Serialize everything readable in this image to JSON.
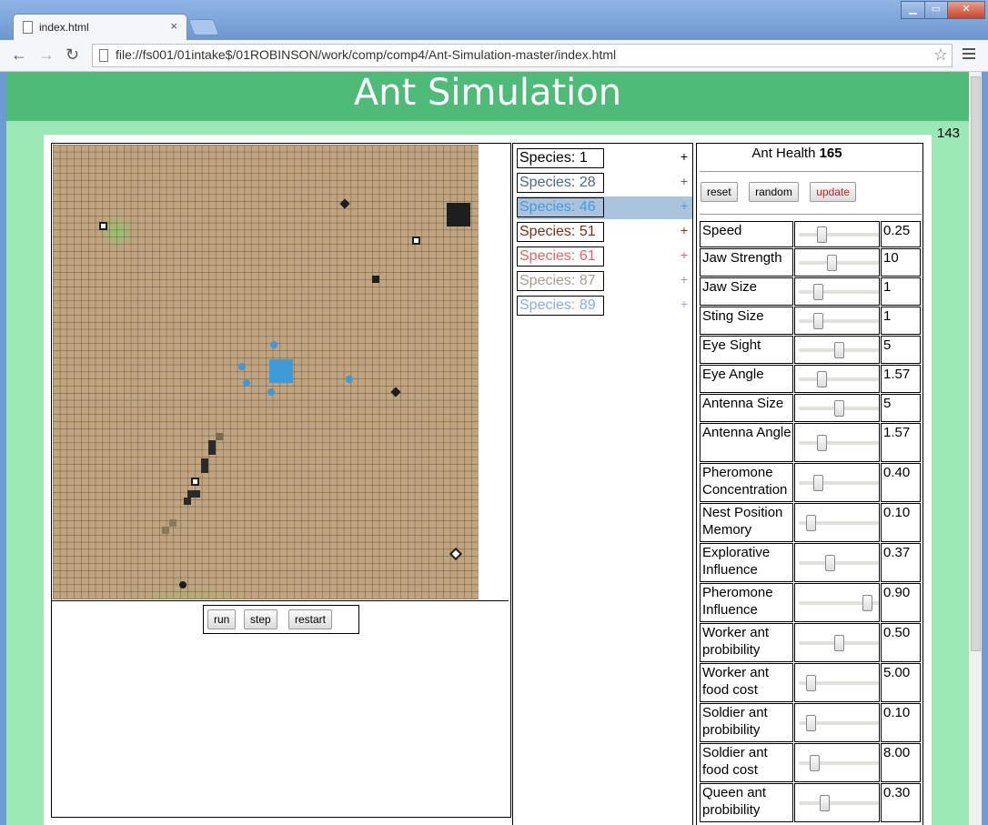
{
  "browser": {
    "tab_title": "index.html",
    "tab_close": "×",
    "url": "file://fs001/01intake$/01ROBINSON/work/comp/comp4/Ant-Simulation-master/index.html",
    "window_buttons": {
      "minimize": "▁",
      "maximize": "▭",
      "close": "✕"
    },
    "nav": {
      "back": "←",
      "forward": "→",
      "reload": "↻"
    },
    "star": "☆"
  },
  "page": {
    "title": "Ant Simulation",
    "counter": "143",
    "controls": {
      "run": "run",
      "step": "step",
      "restart": "restart"
    }
  },
  "species": [
    {
      "label": "Species: 1",
      "color": "#000000",
      "plus_color": "#000000"
    },
    {
      "label": "Species: 28",
      "color": "#4d6a79",
      "plus_color": "#4d6a79"
    },
    {
      "label": "Species: 46",
      "color": "#4a9ad9",
      "plus_color": "#4a9ad9",
      "selected": true
    },
    {
      "label": "Species: 51",
      "color": "#7a2d1b",
      "plus_color": "#7a2d1b"
    },
    {
      "label": "Species: 61",
      "color": "#e0636c",
      "plus_color": "#e0636c"
    },
    {
      "label": "Species: 87",
      "color": "#a5a092",
      "plus_color": "#a5a092"
    },
    {
      "label": "Species: 89",
      "color": "#8fa9d8",
      "plus_color": "#8fa9d8"
    }
  ],
  "plus": "+",
  "health": {
    "label": "Ant Health",
    "value": "165"
  },
  "buttons": {
    "reset": "reset",
    "random": "random",
    "update": "update"
  },
  "params": [
    {
      "label": "Speed",
      "value": "0.25",
      "slider": 0.25
    },
    {
      "label": "Jaw Strength",
      "value": "10",
      "slider": 0.4
    },
    {
      "label": "Jaw Size",
      "value": "1",
      "slider": 0.2
    },
    {
      "label": "Sting Size",
      "value": "1",
      "slider": 0.2
    },
    {
      "label": "Eye Sight",
      "value": "5",
      "slider": 0.5
    },
    {
      "label": "Eye Angle",
      "value": "1.57",
      "slider": 0.25
    },
    {
      "label": "Antenna Size",
      "value": "5",
      "slider": 0.5
    },
    {
      "label": "Antenna Angle",
      "value": "1.57",
      "slider": 0.25
    },
    {
      "label": "Pheromone Concentration",
      "value": "0.40",
      "slider": 0.2
    },
    {
      "label": "Nest Position Memory",
      "value": "0.10",
      "slider": 0.1
    },
    {
      "label": "Explorative Influence",
      "value": "0.37",
      "slider": 0.37
    },
    {
      "label": "Pheromone Influence",
      "value": "0.90",
      "slider": 0.9
    },
    {
      "label": "Worker ant probibility",
      "value": "0.50",
      "slider": 0.5
    },
    {
      "label": "Worker ant food cost",
      "value": "5.00",
      "slider": 0.1
    },
    {
      "label": "Soldier ant probibility",
      "value": "0.10",
      "slider": 0.1
    },
    {
      "label": "Soldier ant food cost",
      "value": "8.00",
      "slider": 0.16
    },
    {
      "label": "Queen ant probibility",
      "value": "0.30",
      "slider": 0.3
    }
  ]
}
